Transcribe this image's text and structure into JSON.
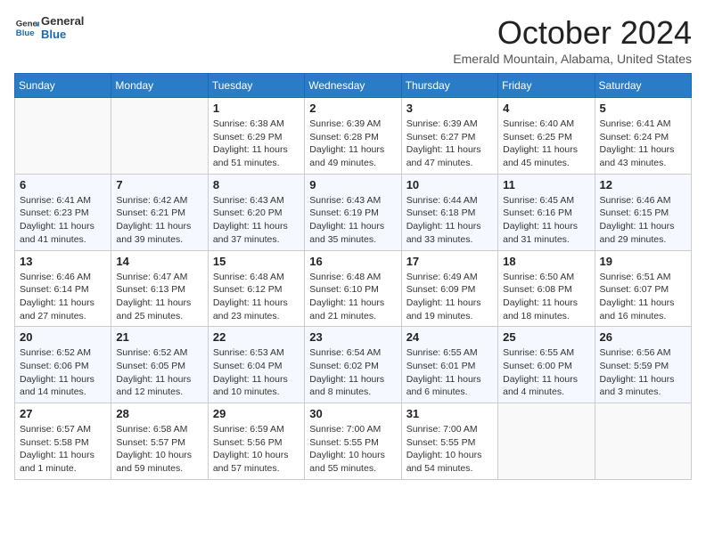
{
  "logo": {
    "line1": "General",
    "line2": "Blue"
  },
  "title": "October 2024",
  "location": "Emerald Mountain, Alabama, United States",
  "days_of_week": [
    "Sunday",
    "Monday",
    "Tuesday",
    "Wednesday",
    "Thursday",
    "Friday",
    "Saturday"
  ],
  "weeks": [
    [
      {
        "day": "",
        "detail": ""
      },
      {
        "day": "",
        "detail": ""
      },
      {
        "day": "1",
        "detail": "Sunrise: 6:38 AM\nSunset: 6:29 PM\nDaylight: 11 hours and 51 minutes."
      },
      {
        "day": "2",
        "detail": "Sunrise: 6:39 AM\nSunset: 6:28 PM\nDaylight: 11 hours and 49 minutes."
      },
      {
        "day": "3",
        "detail": "Sunrise: 6:39 AM\nSunset: 6:27 PM\nDaylight: 11 hours and 47 minutes."
      },
      {
        "day": "4",
        "detail": "Sunrise: 6:40 AM\nSunset: 6:25 PM\nDaylight: 11 hours and 45 minutes."
      },
      {
        "day": "5",
        "detail": "Sunrise: 6:41 AM\nSunset: 6:24 PM\nDaylight: 11 hours and 43 minutes."
      }
    ],
    [
      {
        "day": "6",
        "detail": "Sunrise: 6:41 AM\nSunset: 6:23 PM\nDaylight: 11 hours and 41 minutes."
      },
      {
        "day": "7",
        "detail": "Sunrise: 6:42 AM\nSunset: 6:21 PM\nDaylight: 11 hours and 39 minutes."
      },
      {
        "day": "8",
        "detail": "Sunrise: 6:43 AM\nSunset: 6:20 PM\nDaylight: 11 hours and 37 minutes."
      },
      {
        "day": "9",
        "detail": "Sunrise: 6:43 AM\nSunset: 6:19 PM\nDaylight: 11 hours and 35 minutes."
      },
      {
        "day": "10",
        "detail": "Sunrise: 6:44 AM\nSunset: 6:18 PM\nDaylight: 11 hours and 33 minutes."
      },
      {
        "day": "11",
        "detail": "Sunrise: 6:45 AM\nSunset: 6:16 PM\nDaylight: 11 hours and 31 minutes."
      },
      {
        "day": "12",
        "detail": "Sunrise: 6:46 AM\nSunset: 6:15 PM\nDaylight: 11 hours and 29 minutes."
      }
    ],
    [
      {
        "day": "13",
        "detail": "Sunrise: 6:46 AM\nSunset: 6:14 PM\nDaylight: 11 hours and 27 minutes."
      },
      {
        "day": "14",
        "detail": "Sunrise: 6:47 AM\nSunset: 6:13 PM\nDaylight: 11 hours and 25 minutes."
      },
      {
        "day": "15",
        "detail": "Sunrise: 6:48 AM\nSunset: 6:12 PM\nDaylight: 11 hours and 23 minutes."
      },
      {
        "day": "16",
        "detail": "Sunrise: 6:48 AM\nSunset: 6:10 PM\nDaylight: 11 hours and 21 minutes."
      },
      {
        "day": "17",
        "detail": "Sunrise: 6:49 AM\nSunset: 6:09 PM\nDaylight: 11 hours and 19 minutes."
      },
      {
        "day": "18",
        "detail": "Sunrise: 6:50 AM\nSunset: 6:08 PM\nDaylight: 11 hours and 18 minutes."
      },
      {
        "day": "19",
        "detail": "Sunrise: 6:51 AM\nSunset: 6:07 PM\nDaylight: 11 hours and 16 minutes."
      }
    ],
    [
      {
        "day": "20",
        "detail": "Sunrise: 6:52 AM\nSunset: 6:06 PM\nDaylight: 11 hours and 14 minutes."
      },
      {
        "day": "21",
        "detail": "Sunrise: 6:52 AM\nSunset: 6:05 PM\nDaylight: 11 hours and 12 minutes."
      },
      {
        "day": "22",
        "detail": "Sunrise: 6:53 AM\nSunset: 6:04 PM\nDaylight: 11 hours and 10 minutes."
      },
      {
        "day": "23",
        "detail": "Sunrise: 6:54 AM\nSunset: 6:02 PM\nDaylight: 11 hours and 8 minutes."
      },
      {
        "day": "24",
        "detail": "Sunrise: 6:55 AM\nSunset: 6:01 PM\nDaylight: 11 hours and 6 minutes."
      },
      {
        "day": "25",
        "detail": "Sunrise: 6:55 AM\nSunset: 6:00 PM\nDaylight: 11 hours and 4 minutes."
      },
      {
        "day": "26",
        "detail": "Sunrise: 6:56 AM\nSunset: 5:59 PM\nDaylight: 11 hours and 3 minutes."
      }
    ],
    [
      {
        "day": "27",
        "detail": "Sunrise: 6:57 AM\nSunset: 5:58 PM\nDaylight: 11 hours and 1 minute."
      },
      {
        "day": "28",
        "detail": "Sunrise: 6:58 AM\nSunset: 5:57 PM\nDaylight: 10 hours and 59 minutes."
      },
      {
        "day": "29",
        "detail": "Sunrise: 6:59 AM\nSunset: 5:56 PM\nDaylight: 10 hours and 57 minutes."
      },
      {
        "day": "30",
        "detail": "Sunrise: 7:00 AM\nSunset: 5:55 PM\nDaylight: 10 hours and 55 minutes."
      },
      {
        "day": "31",
        "detail": "Sunrise: 7:00 AM\nSunset: 5:55 PM\nDaylight: 10 hours and 54 minutes."
      },
      {
        "day": "",
        "detail": ""
      },
      {
        "day": "",
        "detail": ""
      }
    ]
  ]
}
